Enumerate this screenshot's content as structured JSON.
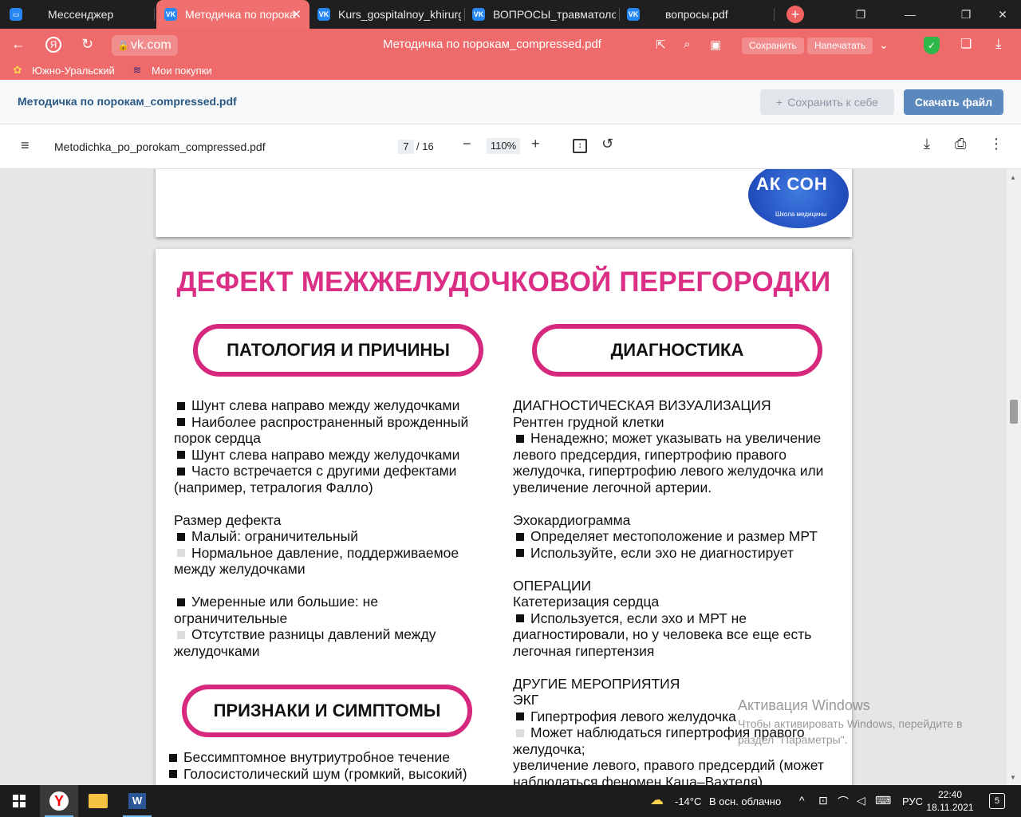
{
  "browser": {
    "tabs": [
      {
        "label": "Мессенджер",
        "icon": "message-icon",
        "active": false
      },
      {
        "label": "Методичка по порока",
        "icon": "vk-icon",
        "active": true
      },
      {
        "label": "Kurs_gospitalnoy_khirurgi",
        "icon": "vk-icon",
        "active": false
      },
      {
        "label": "ВОПРОСЫ_травматологи",
        "icon": "vk-icon",
        "active": false
      },
      {
        "label": "вопросы.pdf",
        "icon": "vk-icon",
        "active": false
      }
    ],
    "tab_close": "✕",
    "new_tab": "+",
    "url": "vk.com",
    "page_title": "Методичка по порокам_compressed.pdf",
    "save_label": "Сохранить",
    "print_label": "Напечатать",
    "bookmarks": [
      {
        "label": "Южно-Уральский",
        "icon": "university-icon"
      },
      {
        "label": "Мои покупки",
        "icon": "purchases-icon"
      }
    ],
    "accent_color": "#ef6b6b"
  },
  "vk": {
    "doc_title": "Методичка по порокам_compressed.pdf",
    "save_to_self": "Сохранить к себе",
    "download": "Скачать файл"
  },
  "pdf_toolbar": {
    "filename": "Metodichka_po_porokam_compressed.pdf",
    "current_page": "7",
    "total_pages": "/ 16",
    "zoom": "110%"
  },
  "logo": {
    "text": "АК    СОН",
    "subtitle": "Школа медицины"
  },
  "document": {
    "title": "ДЕФЕКТ МЕЖЖЕЛУДОЧКОВОЙ ПЕРЕГОРОДКИ",
    "title_color": "#db2f86",
    "section_left": "ПАТОЛОГИЯ И ПРИЧИНЫ",
    "section_right": "ДИАГНОСТИКА",
    "section_symptoms": "ПРИЗНАКИ И СИМПТОМЫ",
    "left_lines": {
      "l1": "Шунт слева направо между желудочками",
      "l2": "Наиболее распространенный врожденный",
      "l3": "порок сердца",
      "l4": "Шунт слева направо между желудочками",
      "l5": "Часто встречается с другими дефектами",
      "l6": "(например, тетралогия Фалло)",
      "l7": "Размер дефекта",
      "l8": "Малый: ограничительный",
      "l9": "Нормальное давление, поддерживаемое",
      "l10": "между желудочками",
      "l11": "Умеренные или большие: не",
      "l12": "ограничительные",
      "l13": "Отсутствие разницы давлений между",
      "l14": "желудочками"
    },
    "right_lines": {
      "r1": "ДИАГНОСТИЧЕСКАЯ ВИЗУАЛИЗАЦИЯ",
      "r2": "Рентген грудной клетки",
      "r3": "Ненадежно; может указывать на увеличение",
      "r4": "левого предсердия, гипертрофию правого",
      "r5": "желудочка, гипертрофию левого желудочка или",
      "r6": "увеличение легочной артерии.",
      "r7": "Эхокардиограмма",
      "r8": "Определяет местоположение и размер МРТ",
      "r9": "Используйте, если эхо не диагностирует",
      "r10": "ОПЕРАЦИИ",
      "r11": "Катетеризация сердца",
      "r12": "Используется, если эхо и МРТ не",
      "r13": "диагностировали, но у человека все еще есть",
      "r14": "легочная гипертензия",
      "r15": "ДРУГИЕ МЕРОПРИЯТИЯ",
      "r16": "ЭКГ",
      "r17": "Гипертрофия левого желудочка",
      "r18": "Может наблюдаться гипертрофия правого",
      "r19": "желудочка;",
      "r20": "увеличение левого, правого предсердий (может",
      "r21": "наблюдаться феномен Каца–Вахтеля)"
    },
    "symptom_lines": {
      "s1": "Бессимптомное внутриутробное течение",
      "s2": "Голосистолический шум (громкий, высокий)"
    }
  },
  "watermark": {
    "title": "Активация Windows",
    "text": "Чтобы активировать Windows, перейдите в раздел \"Параметры\"."
  },
  "taskbar": {
    "temperature": "-14°C",
    "weather": "В осн. облачно",
    "language": "РУС",
    "time": "22:40",
    "date": "18.11.2021",
    "notifications": "5"
  }
}
